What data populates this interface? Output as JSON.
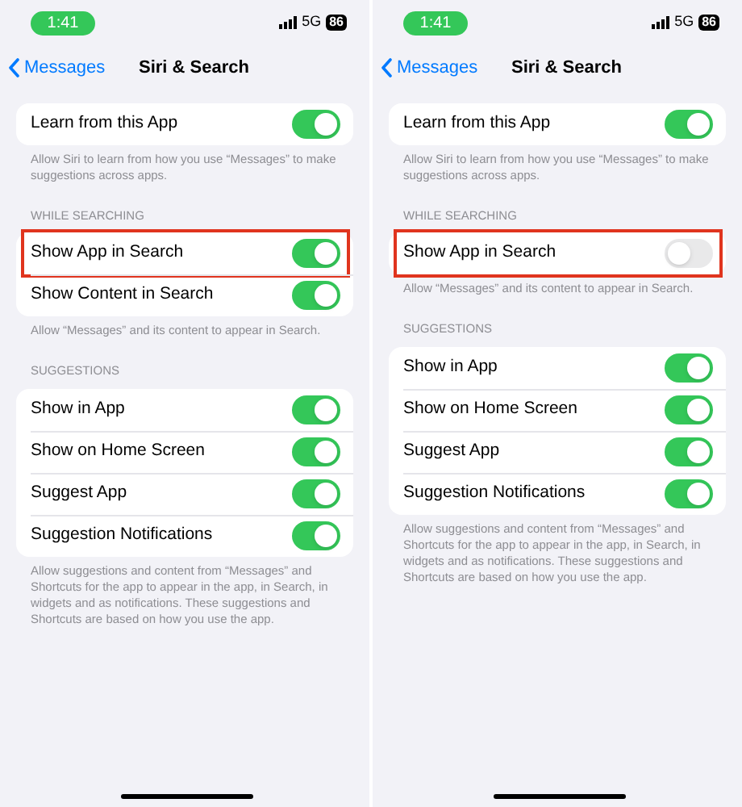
{
  "panels": [
    {
      "status_bar": {
        "time": "1:41",
        "network": "5G",
        "battery": "86"
      },
      "nav": {
        "back": "Messages",
        "title": "Siri & Search"
      },
      "sections": [
        {
          "rows": [
            {
              "label": "Learn from this App",
              "on": true,
              "highlighted": false
            }
          ],
          "footer": "Allow Siri to learn from how you use “Messages” to make suggestions across apps."
        },
        {
          "header": "WHILE SEARCHING",
          "rows": [
            {
              "label": "Show App in Search",
              "on": true,
              "highlighted": true
            },
            {
              "label": "Show Content in Search",
              "on": true,
              "highlighted": false
            }
          ],
          "footer": "Allow “Messages” and its content to appear in Search."
        },
        {
          "header": "SUGGESTIONS",
          "rows": [
            {
              "label": "Show in App",
              "on": true,
              "highlighted": false
            },
            {
              "label": "Show on Home Screen",
              "on": true,
              "highlighted": false
            },
            {
              "label": "Suggest App",
              "on": true,
              "highlighted": false
            },
            {
              "label": "Suggestion Notifications",
              "on": true,
              "highlighted": false
            }
          ],
          "footer": "Allow suggestions and content from “Messages” and Shortcuts for the app to appear in the app, in Search, in widgets and as notifications. These suggestions and Shortcuts are based on how you use the app."
        }
      ]
    },
    {
      "status_bar": {
        "time": "1:41",
        "network": "5G",
        "battery": "86"
      },
      "nav": {
        "back": "Messages",
        "title": "Siri & Search"
      },
      "sections": [
        {
          "rows": [
            {
              "label": "Learn from this App",
              "on": true,
              "highlighted": false
            }
          ],
          "footer": "Allow Siri to learn from how you use “Messages” to make suggestions across apps."
        },
        {
          "header": "WHILE SEARCHING",
          "rows": [
            {
              "label": "Show App in Search",
              "on": false,
              "highlighted": true
            }
          ],
          "footer": "Allow “Messages” and its content to appear in Search."
        },
        {
          "header": "SUGGESTIONS",
          "rows": [
            {
              "label": "Show in App",
              "on": true,
              "highlighted": false
            },
            {
              "label": "Show on Home Screen",
              "on": true,
              "highlighted": false
            },
            {
              "label": "Suggest App",
              "on": true,
              "highlighted": false
            },
            {
              "label": "Suggestion Notifications",
              "on": true,
              "highlighted": false
            }
          ],
          "footer": "Allow suggestions and content from “Messages” and Shortcuts for the app to appear in the app, in Search, in widgets and as notifications. These suggestions and Shortcuts are based on how you use the app."
        }
      ]
    }
  ]
}
